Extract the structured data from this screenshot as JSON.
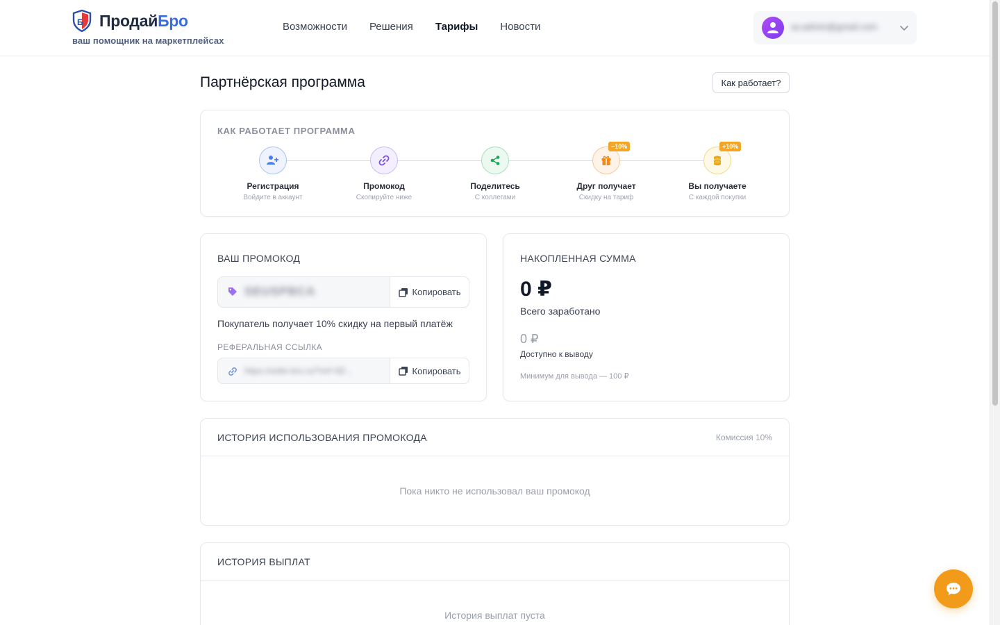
{
  "brand": {
    "name_part1": "Продай",
    "name_part2": "Бро",
    "tagline": "ваш помощник на маркетплейсах"
  },
  "nav": [
    {
      "label": "Возможности",
      "active": false
    },
    {
      "label": "Решения",
      "active": false
    },
    {
      "label": "Тарифы",
      "active": true
    },
    {
      "label": "Новости",
      "active": false
    }
  ],
  "user": {
    "email": "av.admin@gmail.com"
  },
  "page": {
    "title": "Партнёрская программа",
    "how_button": "Как работает?"
  },
  "steps": {
    "label": "КАК РАБОТАЕТ ПРОГРАММА",
    "items": [
      {
        "title": "Регистрация",
        "sub": "Войдите в аккаунт",
        "icon": "user-plus-icon",
        "color": "#4a7ef0",
        "badge": ""
      },
      {
        "title": "Промокод",
        "sub": "Скопируйте ниже",
        "icon": "link-icon",
        "color": "#7c4fe0",
        "badge": ""
      },
      {
        "title": "Поделитесь",
        "sub": "С коллегами",
        "icon": "share-icon",
        "color": "#1fa35a",
        "badge": ""
      },
      {
        "title": "Друг получает",
        "sub": "Скидку на тариф",
        "icon": "gift-icon",
        "color": "#f08a1c",
        "badge": "−10%"
      },
      {
        "title": "Вы получаете",
        "sub": "С каждой покупки",
        "icon": "coins-icon",
        "color": "#e6a81a",
        "badge": "+10%"
      }
    ]
  },
  "promo": {
    "label": "ВАШ ПРОМОКОД",
    "code": "SEUSPBCA",
    "copy_label": "Копировать",
    "note": "Покупатель получает 10% скидку на первый платёж",
    "ref_label": "РЕФЕРАЛЬНАЯ ССЫЛКА",
    "ref_link": "https://seller.bro.ru/?ref=SE..."
  },
  "sum": {
    "label": "НАКОПЛЕННАЯ СУММА",
    "total": "0 ₽",
    "total_label": "Всего заработано",
    "available": "0 ₽",
    "available_label": "Доступно к выводу",
    "min_note": "Минимум для вывода — 100 ₽"
  },
  "history": {
    "label": "ИСТОРИЯ ИСПОЛЬЗОВАНИЯ ПРОМОКОДА",
    "commission": "Комиссия 10%",
    "empty": "Пока никто не использовал ваш промокод"
  },
  "payouts": {
    "label": "ИСТОРИЯ ВЫПЛАТ",
    "empty": "История выплат пуста"
  },
  "colors": {
    "accent": "#3b6de0",
    "chat": "#f29b1a",
    "avatar": "#9b45f2"
  }
}
